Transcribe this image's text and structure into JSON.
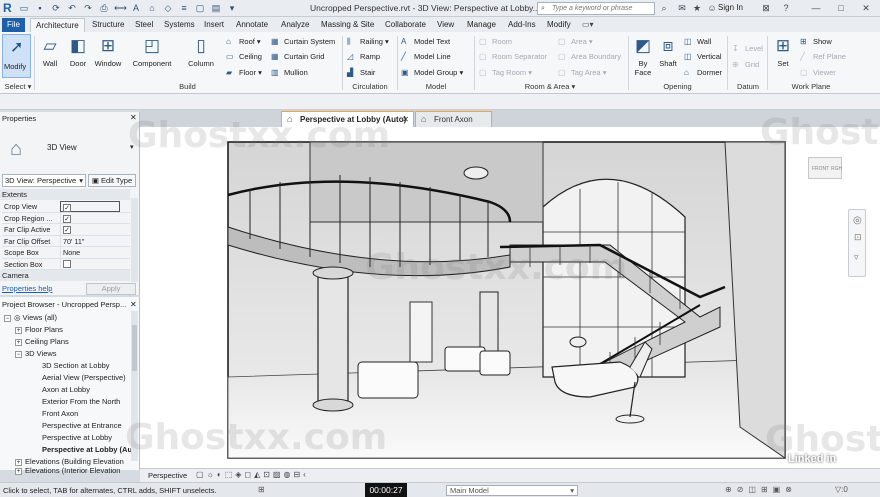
{
  "titlebar": {
    "app_letter": "R",
    "title": "Uncropped Perspective.rvt - 3D View: Perspective at Lobby...",
    "search_placeholder": "Type a keyword or phrase",
    "sign_in": "Sign In"
  },
  "ribbon_tabs": [
    "File",
    "Architecture",
    "Structure",
    "Steel",
    "Systems",
    "Insert",
    "Annotate",
    "Analyze",
    "Massing & Site",
    "Collaborate",
    "View",
    "Manage",
    "Add-Ins",
    "Modify"
  ],
  "ribbon": {
    "modify": "Modify",
    "select": "Select",
    "build": {
      "wall": "Wall",
      "door": "Door",
      "window": "Window",
      "component": "Component",
      "column": "Column",
      "roof": "Roof",
      "ceiling": "Ceiling",
      "floor": "Floor",
      "curtain_system": "Curtain System",
      "curtain_grid": "Curtain Grid",
      "mullion": "Mullion",
      "label": "Build"
    },
    "circulation": {
      "railing": "Railing",
      "ramp": "Ramp",
      "stair": "Stair",
      "label": "Circulation"
    },
    "model": {
      "model_text": "Model Text",
      "model_line": "Model Line",
      "model_group": "Model Group",
      "label": "Model"
    },
    "room_area": {
      "room": "Room",
      "room_separator": "Room Separator",
      "tag_room": "Tag Room",
      "area": "Area",
      "area_boundary": "Area Boundary",
      "tag_area": "Tag Area",
      "label": "Room & Area"
    },
    "opening": {
      "by_face": "By Face",
      "shaft": "Shaft",
      "wall": "Wall",
      "vertical": "Vertical",
      "dormer": "Dormer",
      "label": "Opening"
    },
    "datum": {
      "level": "Level",
      "grid": "Grid",
      "label": "Datum"
    },
    "work_plane": {
      "set": "Set",
      "show": "Show",
      "ref_plane": "Ref Plane",
      "viewer": "Viewer",
      "label": "Work Plane"
    }
  },
  "properties": {
    "title": "Properties",
    "type_name": "3D View",
    "instance": "3D View: Perspective",
    "edit_type": "Edit Type",
    "extents": "Extents",
    "rows": [
      {
        "key": "Crop View",
        "value": "",
        "check": "✓"
      },
      {
        "key": "Crop Region ...",
        "value": "",
        "check": "✓"
      },
      {
        "key": "Far Clip Active",
        "value": "",
        "check": "✓"
      },
      {
        "key": "Far Clip Offset",
        "value": "70'  11\"",
        "check": ""
      },
      {
        "key": "Scope Box",
        "value": "None",
        "check": ""
      },
      {
        "key": "Section Box",
        "value": "",
        "check": ""
      }
    ],
    "camera": "Camera",
    "help": "Properties help",
    "apply": "Apply"
  },
  "project_browser": {
    "title": "Project Browser - Uncropped Persp...",
    "items": [
      {
        "label": "Views (all)",
        "toggle": "−"
      },
      {
        "label": "Floor Plans",
        "toggle": "+"
      },
      {
        "label": "Ceiling Plans",
        "toggle": "+"
      },
      {
        "label": "3D Views",
        "toggle": "−"
      },
      {
        "label": "3D Section at Lobby",
        "toggle": ""
      },
      {
        "label": "Aerial View (Perspective)",
        "toggle": ""
      },
      {
        "label": "Axon at Lobby",
        "toggle": ""
      },
      {
        "label": "Exterior From the North",
        "toggle": ""
      },
      {
        "label": "Front Axon",
        "toggle": ""
      },
      {
        "label": "Perspective at Entrance",
        "toggle": ""
      },
      {
        "label": "Perspective at Lobby",
        "toggle": ""
      },
      {
        "label": "Perspective at Lobby (Au",
        "toggle": ""
      },
      {
        "label": "Elevations (Building Elevation",
        "toggle": "+"
      },
      {
        "label": "Elevations (Interior Elevation",
        "toggle": "+"
      }
    ]
  },
  "view_tabs": [
    "Perspective at Lobby (Auto)",
    "Front Axon"
  ],
  "view_control": {
    "mode": "Perspective"
  },
  "status": {
    "hint": "Click to select, TAB for alternates, CTRL adds, SHIFT unselects.",
    "time": "00:00:27",
    "workset": "Main Model"
  },
  "viewcube": {
    "front": "FRONT",
    "right": "RGH"
  },
  "watermark": {
    "text": "Ghostxx.com",
    "brand": "Linked in"
  }
}
